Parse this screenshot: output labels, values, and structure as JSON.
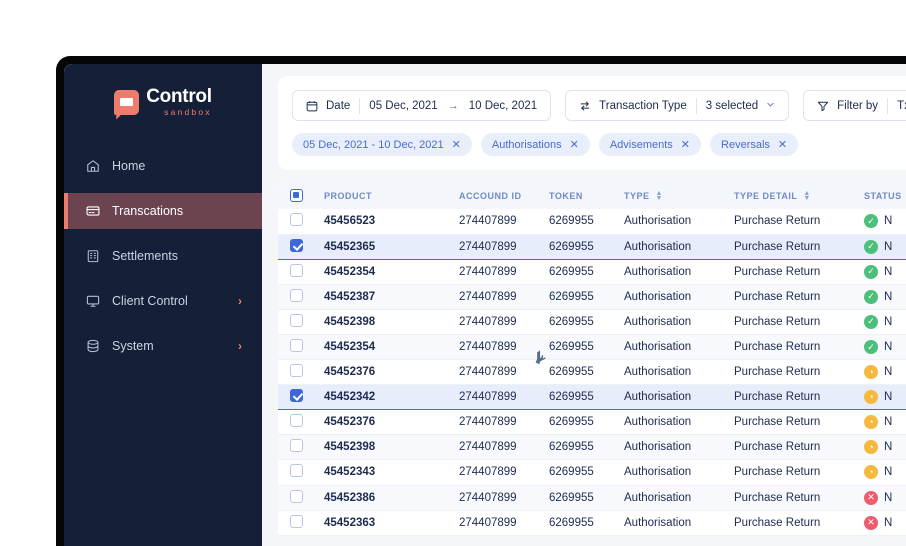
{
  "brand": {
    "name": "Control",
    "tagline": "sandbox",
    "logo_icon": "chat-bubble-card-icon",
    "accent_color": "#ef7b6d",
    "sidebar_bg": "#152038",
    "active_bg": "#6b4450",
    "primary_blue": "#3e68d8"
  },
  "sidebar": {
    "items": [
      {
        "label": "Home",
        "icon": "home-icon",
        "active": false,
        "expandable": false
      },
      {
        "label": "Transcations",
        "icon": "credit-card-icon",
        "active": true,
        "expandable": false
      },
      {
        "label": "Settlements",
        "icon": "building-icon",
        "active": false,
        "expandable": false
      },
      {
        "label": "Client Control",
        "icon": "monitor-icon",
        "active": false,
        "expandable": true,
        "chevron": "›"
      },
      {
        "label": "System",
        "icon": "database-icon",
        "active": false,
        "expandable": true,
        "chevron": "›"
      }
    ]
  },
  "toolbar": {
    "date_filter": {
      "icon": "calendar-icon",
      "label": "Date",
      "from": "05 Dec, 2021",
      "range_arrow": "→",
      "to": "10 Dec, 2021"
    },
    "transaction_type_filter": {
      "icon": "transfer-arrows-icon",
      "label": "Transaction Type",
      "value": "3 selected",
      "caret": "⌄"
    },
    "filter_by": {
      "icon": "funnel-icon",
      "label": "Filter by",
      "value": "Txn Status",
      "caret": "⌄"
    }
  },
  "chips": [
    {
      "label": "05 Dec, 2021 - 10 Dec, 2021",
      "close": "✕"
    },
    {
      "label": "Authorisations",
      "close": "✕"
    },
    {
      "label": "Advisements",
      "close": "✕"
    },
    {
      "label": "Reversals",
      "close": "✕"
    }
  ],
  "table": {
    "select_all_state": "indeterminate",
    "columns": [
      {
        "key": "checkbox",
        "label": "",
        "sortable": false
      },
      {
        "key": "product",
        "label": "PRODUCT",
        "sortable": false
      },
      {
        "key": "account_id",
        "label": "ACCOUND ID",
        "sortable": false
      },
      {
        "key": "token",
        "label": "TOKEN",
        "sortable": false
      },
      {
        "key": "type",
        "label": "TYPE",
        "sortable": true
      },
      {
        "key": "type_detail",
        "label": "TYPE DETAIL",
        "sortable": true
      },
      {
        "key": "status",
        "label": "STATUS",
        "sortable": false
      }
    ],
    "rows": [
      {
        "checked": false,
        "product": "45456523",
        "account_id": "274407899",
        "token": "6269955",
        "type": "Authorisation",
        "type_detail": "Purchase Return",
        "status": "N",
        "status_kind": "ok"
      },
      {
        "checked": true,
        "product": "45452365",
        "account_id": "274407899",
        "token": "6269955",
        "type": "Authorisation",
        "type_detail": "Purchase Return",
        "status": "N",
        "status_kind": "ok"
      },
      {
        "checked": false,
        "product": "45452354",
        "account_id": "274407899",
        "token": "6269955",
        "type": "Authorisation",
        "type_detail": "Purchase Return",
        "status": "N",
        "status_kind": "ok"
      },
      {
        "checked": false,
        "product": "45452387",
        "account_id": "274407899",
        "token": "6269955",
        "type": "Authorisation",
        "type_detail": "Purchase Return",
        "status": "N",
        "status_kind": "ok"
      },
      {
        "checked": false,
        "product": "45452398",
        "account_id": "274407899",
        "token": "6269955",
        "type": "Authorisation",
        "type_detail": "Purchase Return",
        "status": "N",
        "status_kind": "ok"
      },
      {
        "checked": false,
        "product": "45452354",
        "account_id": "274407899",
        "token": "6269955",
        "type": "Authorisation",
        "type_detail": "Purchase Return",
        "status": "N",
        "status_kind": "ok"
      },
      {
        "checked": false,
        "product": "45452376",
        "account_id": "274407899",
        "token": "6269955",
        "type": "Authorisation",
        "type_detail": "Purchase Return",
        "status": "N",
        "status_kind": "pending"
      },
      {
        "checked": true,
        "product": "45452342",
        "account_id": "274407899",
        "token": "6269955",
        "type": "Authorisation",
        "type_detail": "Purchase Return",
        "status": "N",
        "status_kind": "pending"
      },
      {
        "checked": false,
        "product": "45452376",
        "account_id": "274407899",
        "token": "6269955",
        "type": "Authorisation",
        "type_detail": "Purchase Return",
        "status": "N",
        "status_kind": "pending"
      },
      {
        "checked": false,
        "product": "45452398",
        "account_id": "274407899",
        "token": "6269955",
        "type": "Authorisation",
        "type_detail": "Purchase Return",
        "status": "N",
        "status_kind": "pending"
      },
      {
        "checked": false,
        "product": "45452343",
        "account_id": "274407899",
        "token": "6269955",
        "type": "Authorisation",
        "type_detail": "Purchase Return",
        "status": "N",
        "status_kind": "pending"
      },
      {
        "checked": false,
        "product": "45452386",
        "account_id": "274407899",
        "token": "6269955",
        "type": "Authorisation",
        "type_detail": "Purchase Return",
        "status": "N",
        "status_kind": "fail"
      },
      {
        "checked": false,
        "product": "45452363",
        "account_id": "274407899",
        "token": "6269955",
        "type": "Authorisation",
        "type_detail": "Purchase Return",
        "status": "N",
        "status_kind": "fail"
      }
    ]
  },
  "status_icons": {
    "ok": "✓",
    "pending": "◔",
    "fail": "✕"
  }
}
